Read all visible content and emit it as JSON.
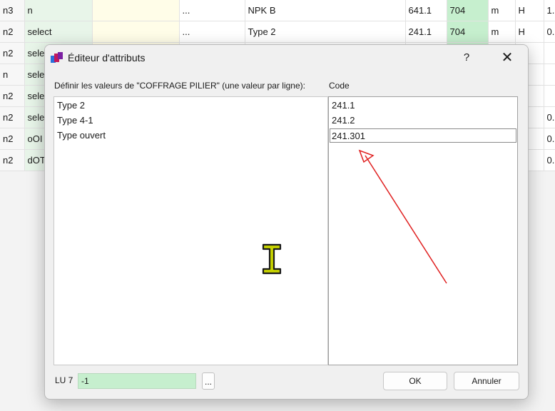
{
  "background_table": {
    "rows": [
      [
        "n3",
        "n",
        "",
        "...",
        "NPK B",
        "641.1",
        "704",
        "m",
        "H",
        "1."
      ],
      [
        "n2",
        "select",
        "",
        "...",
        "Type 2",
        "241.1",
        "704",
        "m",
        "H",
        "0."
      ],
      [
        "n2",
        "sele",
        "",
        "",
        "",
        "",
        "",
        "",
        "",
        ""
      ],
      [
        "n",
        "sele",
        "",
        "",
        "",
        "",
        "",
        "",
        "",
        ""
      ],
      [
        "n2",
        "sele",
        "",
        "",
        "",
        "",
        "",
        "",
        "",
        ""
      ],
      [
        "n2",
        "sele",
        "",
        "",
        "",
        "",
        "",
        "",
        "",
        "0."
      ],
      [
        "n2",
        "oOI",
        "",
        "",
        "",
        "",
        "",
        "",
        "",
        "0."
      ],
      [
        "n2",
        "dOT",
        "",
        "",
        "",
        "",
        "",
        "",
        "",
        "0."
      ]
    ]
  },
  "dialog": {
    "title": "Éditeur d'attributs",
    "help_label": "?",
    "close_label": "✕",
    "instruction": "Définir les valeurs de \"COFFRAGE PILIER\" (une valeur par ligne):",
    "code_label": "Code",
    "values": [
      "Type 2",
      "Type 4-1",
      "Type ouvert"
    ],
    "codes": [
      "241.1",
      "241.2",
      "241.301"
    ],
    "lu_label": "LU 7",
    "lu_value": "-1",
    "more_label": "...",
    "ok_label": "OK",
    "cancel_label": "Annuler"
  },
  "colors": {
    "annotation_arrow": "#e02020",
    "lu_field_bg": "#c6efce",
    "cursor_fill": "#c8d400"
  },
  "icons": {
    "app": "attribute-editor-icon",
    "cursor": "text-ibeam-cursor-icon"
  }
}
